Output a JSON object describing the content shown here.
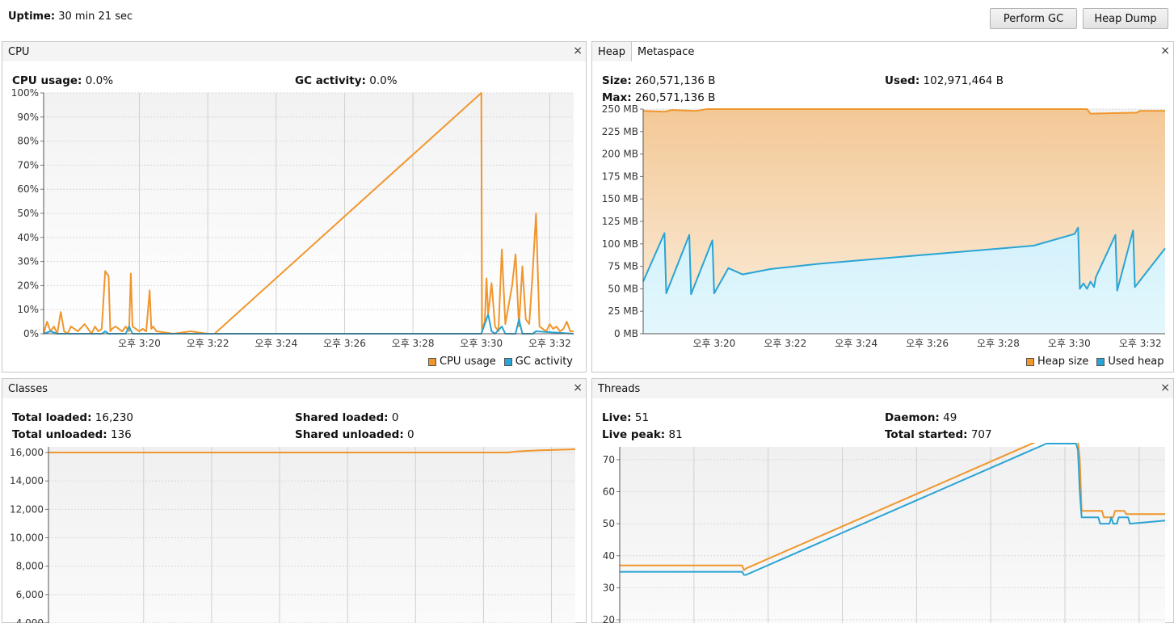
{
  "header": {
    "uptime_label": "Uptime:",
    "uptime_value": "30 min 21 sec",
    "perform_gc_label": "Perform GC",
    "heap_dump_label": "Heap Dump"
  },
  "colors": {
    "orange": "#f0962d",
    "blue": "#29a4d4",
    "orange_fill": "#f3c896",
    "blue_fill": "#d3f1fb"
  },
  "cpu": {
    "tab": "CPU",
    "cpu_usage_label": "CPU usage:",
    "cpu_usage_value": "0.0%",
    "gc_label": "GC activity:",
    "gc_value": "0.0%",
    "legend": [
      "CPU usage",
      "GC activity"
    ]
  },
  "memory": {
    "tabs": [
      "Heap",
      "Metaspace"
    ],
    "size_label": "Size:",
    "size_value": "260,571,136 B",
    "used_label": "Used:",
    "used_value": "102,971,464 B",
    "max_label": "Max:",
    "max_value": "260,571,136 B",
    "legend": [
      "Heap size",
      "Used heap"
    ]
  },
  "classes": {
    "tab": "Classes",
    "total_loaded_label": "Total loaded:",
    "total_loaded_value": "16,230",
    "total_unloaded_label": "Total unloaded:",
    "total_unloaded_value": "136",
    "shared_loaded_label": "Shared loaded:",
    "shared_loaded_value": "0",
    "shared_unloaded_label": "Shared unloaded:",
    "shared_unloaded_value": "0"
  },
  "threads": {
    "tab": "Threads",
    "live_label": "Live:",
    "live_value": "51",
    "daemon_label": "Daemon:",
    "daemon_value": "49",
    "live_peak_label": "Live peak:",
    "live_peak_value": "81",
    "total_started_label": "Total started:",
    "total_started_value": "707"
  },
  "close_glyph": "×",
  "chart_data": [
    {
      "type": "line",
      "id": "cpu",
      "x_ticks": [
        "오후 3:20",
        "오후 3:22",
        "오후 3:24",
        "오후 3:26",
        "오후 3:28",
        "오후 3:30",
        "오후 3:32"
      ],
      "x_tick_minutes": [
        20,
        22,
        24,
        26,
        28,
        30,
        32
      ],
      "xlim": [
        17.2,
        32.7
      ],
      "y_ticks": [
        "0%",
        "10%",
        "20%",
        "30%",
        "40%",
        "50%",
        "60%",
        "70%",
        "80%",
        "90%",
        "100%"
      ],
      "ylim": [
        0,
        100
      ],
      "series": [
        {
          "name": "CPU usage",
          "color": "#f0962d",
          "x": [
            17.2,
            17.3,
            17.4,
            17.5,
            17.6,
            17.7,
            17.8,
            17.9,
            18.0,
            18.2,
            18.4,
            18.6,
            18.7,
            18.8,
            18.9,
            19.0,
            19.1,
            19.15,
            19.2,
            19.3,
            19.4,
            19.5,
            19.6,
            19.7,
            19.75,
            19.8,
            19.9,
            20.0,
            20.1,
            20.2,
            20.3,
            20.35,
            20.4,
            20.5,
            21.0,
            21.5,
            22.0,
            22.2,
            30.0,
            30.02,
            30.1,
            30.15,
            30.2,
            30.3,
            30.4,
            30.5,
            30.6,
            30.7,
            30.8,
            30.9,
            31.0,
            31.1,
            31.2,
            31.3,
            31.4,
            31.5,
            31.6,
            31.7,
            31.8,
            31.9,
            32.0,
            32.1,
            32.2,
            32.3,
            32.4,
            32.5,
            32.6,
            32.7
          ],
          "y": [
            0,
            5,
            1,
            3,
            0,
            9,
            1,
            0,
            3,
            1,
            4,
            0,
            3,
            1,
            2,
            26,
            24,
            1,
            2,
            3,
            2,
            1,
            3,
            1,
            25,
            3,
            2,
            1,
            2,
            1,
            18,
            2,
            3,
            1,
            0,
            1,
            0,
            0,
            100,
            2,
            5,
            23,
            8,
            21,
            3,
            1,
            35,
            4,
            12,
            20,
            33,
            3,
            28,
            6,
            4,
            25,
            50,
            3,
            2,
            1,
            4,
            2,
            3,
            1,
            2,
            5,
            1,
            1
          ]
        },
        {
          "name": "GC activity",
          "color": "#29a4d4",
          "x": [
            17.2,
            17.4,
            17.6,
            18.9,
            19.0,
            19.1,
            19.6,
            19.7,
            19.8,
            30.0,
            30.2,
            30.3,
            30.4,
            30.6,
            30.7,
            31.0,
            31.1,
            31.2,
            31.5,
            31.6,
            32.7
          ],
          "y": [
            0,
            1,
            0,
            0,
            1,
            0,
            0,
            3,
            0,
            0,
            8,
            1,
            0,
            3,
            0,
            0,
            6,
            0,
            0,
            1,
            0
          ]
        }
      ]
    },
    {
      "type": "area",
      "id": "heap",
      "x_ticks": [
        "오후 3:20",
        "오후 3:22",
        "오후 3:24",
        "오후 3:26",
        "오후 3:28",
        "오후 3:30",
        "오후 3:32"
      ],
      "x_tick_minutes": [
        20,
        22,
        24,
        26,
        28,
        30,
        32
      ],
      "xlim": [
        18.0,
        32.7
      ],
      "y_ticks": [
        "0 MB",
        "25 MB",
        "50 MB",
        "75 MB",
        "100 MB",
        "125 MB",
        "150 MB",
        "175 MB",
        "200 MB",
        "225 MB",
        "250 MB"
      ],
      "ylim": [
        0,
        250
      ],
      "series": [
        {
          "name": "Heap size",
          "color": "#f0962d",
          "x": [
            18.0,
            18.6,
            18.8,
            19.5,
            19.8,
            30.5,
            30.6,
            31.9,
            32.0,
            32.7
          ],
          "y": [
            248,
            247,
            249,
            248,
            250,
            250,
            245,
            246,
            248,
            248
          ]
        },
        {
          "name": "Used heap",
          "color": "#29a4d4",
          "x": [
            18.0,
            18.6,
            18.65,
            19.3,
            19.35,
            19.95,
            20.0,
            20.4,
            20.8,
            21.6,
            23.0,
            26.0,
            29.0,
            30.15,
            30.25,
            30.3,
            30.4,
            30.5,
            30.6,
            30.7,
            30.75,
            31.3,
            31.35,
            31.8,
            31.85,
            32.7
          ],
          "y": [
            58,
            112,
            45,
            110,
            44,
            104,
            45,
            73,
            66,
            72,
            78,
            88,
            98,
            111,
            118,
            50,
            56,
            50,
            58,
            52,
            63,
            110,
            48,
            115,
            52,
            95
          ]
        }
      ]
    },
    {
      "type": "line",
      "id": "classes",
      "xlim": [
        17.2,
        32.7
      ],
      "y_ticks": [
        "4,000",
        "6,000",
        "8,000",
        "10,000",
        "12,000",
        "14,000",
        "16,000"
      ],
      "ylim": [
        4000,
        16400
      ],
      "series": [
        {
          "name": "Total loaded",
          "color": "#f0962d",
          "x": [
            17.2,
            30.7,
            31.0,
            31.6,
            32.7
          ],
          "y": [
            16000,
            16000,
            16080,
            16150,
            16230
          ]
        }
      ]
    },
    {
      "type": "line",
      "id": "threads",
      "xlim": [
        18.0,
        32.7
      ],
      "y_ticks": [
        "20",
        "30",
        "40",
        "50",
        "60",
        "70"
      ],
      "ylim": [
        19,
        74
      ],
      "series": [
        {
          "name": "Live peak",
          "color": "#f0962d",
          "x": [
            18.0,
            21.3,
            21.35,
            21.4,
            29.5,
            30.3,
            30.35,
            30.4,
            30.45,
            31.0,
            31.05,
            31.3,
            31.35,
            31.6,
            31.65,
            32.7
          ],
          "y": [
            37,
            37,
            35.5,
            36,
            77,
            77,
            76,
            70,
            54,
            54,
            52,
            52,
            54,
            54,
            53,
            53
          ]
        },
        {
          "name": "Live",
          "color": "#29a4d4",
          "x": [
            18.0,
            21.3,
            21.35,
            21.4,
            29.5,
            30.3,
            30.35,
            30.4,
            30.45,
            30.9,
            30.95,
            31.2,
            31.25,
            31.3,
            31.4,
            31.45,
            31.7,
            31.75,
            32.7
          ],
          "y": [
            35,
            35,
            34,
            34,
            75,
            75,
            73,
            60,
            52,
            52,
            50,
            50,
            52,
            50,
            50,
            52,
            52,
            50,
            51
          ]
        }
      ]
    }
  ]
}
